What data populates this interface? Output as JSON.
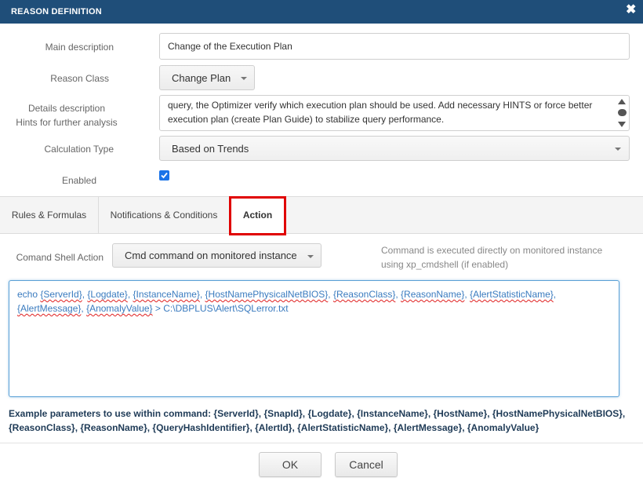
{
  "dialog": {
    "title": "REASON DEFINITION"
  },
  "form": {
    "main_description_label": "Main description",
    "main_description_value": "Change of the Execution Plan",
    "reason_class_label": "Reason Class",
    "reason_class_value": "Change Plan",
    "details_label_line1": "Details description",
    "details_label_line2": "Hints for further analysis",
    "details_line1": "query, the Optimizer verify which execution plan should be used. Add necessary HINTS or force better",
    "details_line2": "execution plan (create Plan Guide) to stabilize query performance.",
    "calculation_type_label": "Calculation Type",
    "calculation_type_value": "Based on Trends",
    "enabled_label": "Enabled",
    "enabled_checked": true
  },
  "tabs": [
    {
      "label": "Rules & Formulas",
      "active": false
    },
    {
      "label": "Notifications & Conditions",
      "active": false
    },
    {
      "label": "Action",
      "active": true
    }
  ],
  "action": {
    "shell_label": "Comand Shell Action",
    "shell_value": "Cmd command on monitored instance",
    "hint_line1": "Command is executed directly on monitored instance",
    "hint_line2": "using xp_cmdshell (if enabled)",
    "command": {
      "t0": "echo ",
      "p1": "{ServerId}",
      "t1": ", ",
      "p2": "{Logdate}",
      "t2": ", ",
      "p3": "{InstanceName}",
      "t3": ", ",
      "p4": "{HostNamePhysicalNetBIOS}",
      "t4": ", ",
      "p5": "{ReasonClass}",
      "t5": ", ",
      "p6": "{ReasonName}",
      "t6": ", ",
      "p7": "{AlertStatisticName}",
      "t7": ",",
      "p8": "{AlertMessage}",
      "t8": ", ",
      "p9": "{AnomalyValue}",
      "t9": " > C:\\DBPLUS\\Alert\\SQLerror.txt"
    },
    "example_line1": "Example parameters to use within command: {ServerId}, {SnapId}, {Logdate}, {InstanceName}, {HostName}, {HostNamePhysicalNetBIOS},",
    "example_line2": "{ReasonClass}, {ReasonName}, {QueryHashIdentifier}, {AlertId}, {AlertStatisticName}, {AlertMessage}, {AnomalyValue}"
  },
  "buttons": {
    "ok": "OK",
    "cancel": "Cancel"
  },
  "colors": {
    "titlebar": "#1f4e79",
    "checkbox": "#1a73e8",
    "highlight": "#e00000",
    "command_text": "#3a7bbf"
  }
}
